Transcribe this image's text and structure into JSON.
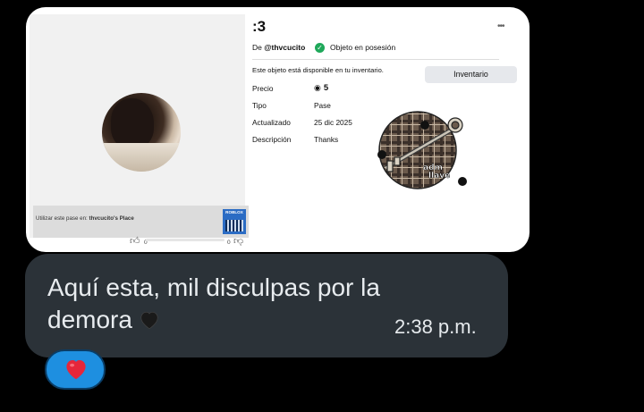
{
  "item": {
    "title": ":3",
    "more_label": "•••",
    "creator_prefix": "De",
    "creator": "@thvcucito",
    "owned_label": "Objeto en posesión",
    "availability_text": "Este objeto está disponible en tu inventario.",
    "inventory_button": "Inventario",
    "price_label": "Precio",
    "price_value": "5",
    "type_label": "Tipo",
    "type_value": "Pase",
    "updated_label": "Actualizado",
    "updated_value": "25 dic 2025",
    "description_label": "Descripción",
    "description_value": "Thanks",
    "image_text_line1": "adm",
    "image_text_line2": "llave"
  },
  "thumbnail": {
    "promo_prefix": "Utilizar este pase en:",
    "promo_place": "thvcucito's Place",
    "logo_text": "ROBLOX",
    "upvotes": "0",
    "downvotes": "0"
  },
  "message": {
    "text": "Aquí esta, mil disculpas por la demora",
    "time": "2:38 p.m.",
    "reaction": "heart"
  },
  "colors": {
    "bubble": "#2b3238",
    "reaction_bg": "#1e8fe0",
    "check": "#1fa85a"
  }
}
